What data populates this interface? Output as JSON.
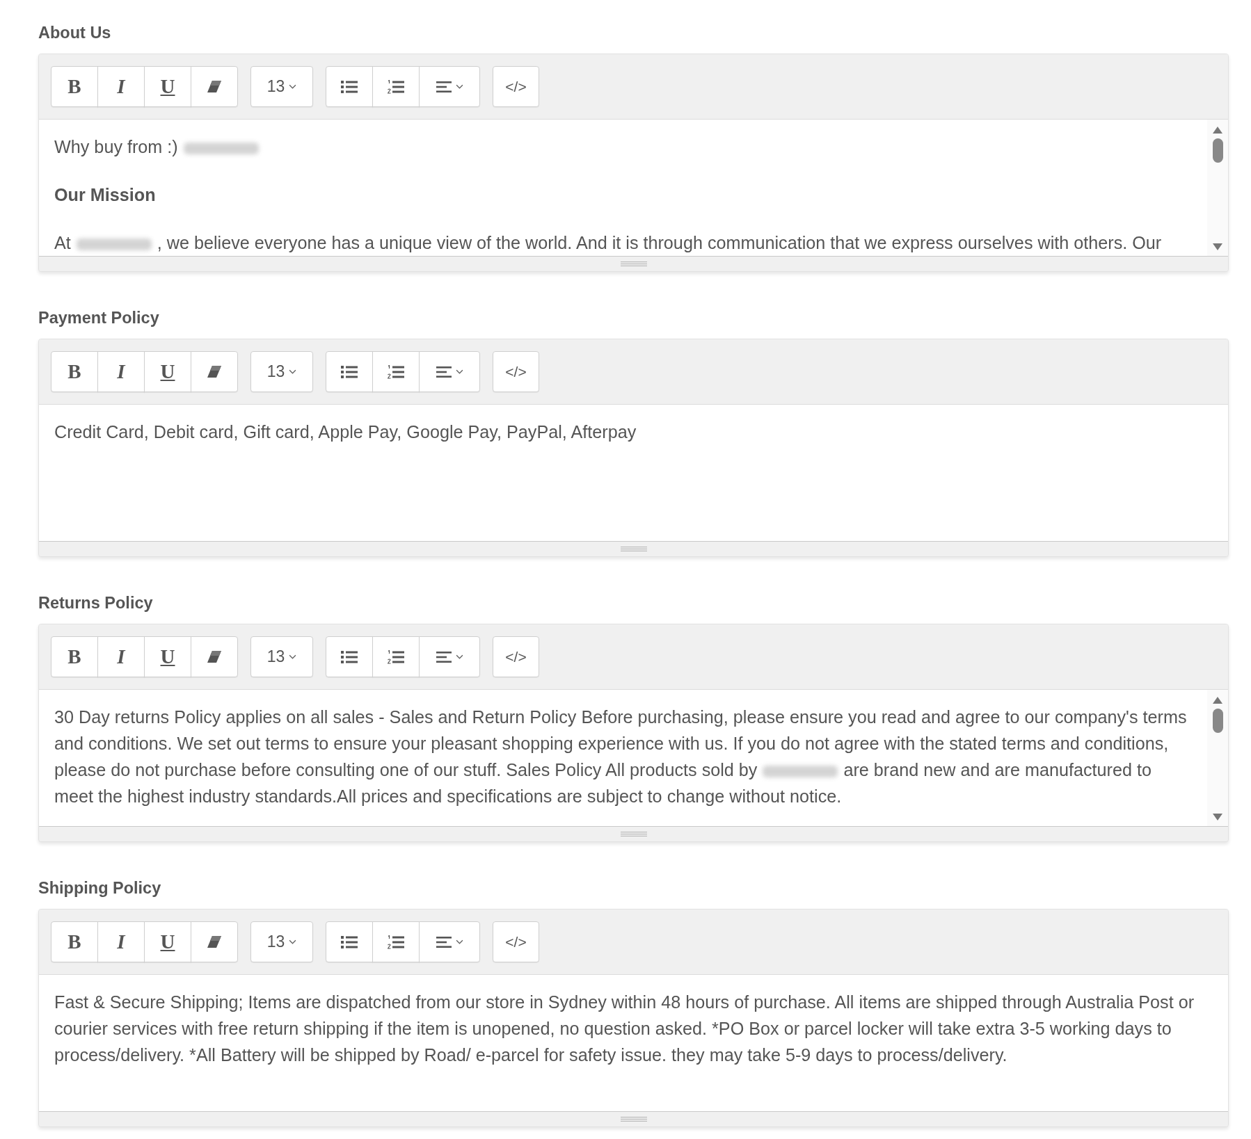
{
  "sections": [
    {
      "label": "About Us",
      "scrollable": true,
      "toolbar": [
        [
          {
            "kind": "bold",
            "label": "B"
          },
          {
            "kind": "italic",
            "label": "I"
          },
          {
            "kind": "underline",
            "label": "U"
          },
          {
            "kind": "eraser"
          }
        ],
        [
          {
            "kind": "font-size",
            "label": "13"
          }
        ],
        [
          {
            "kind": "bullet-list"
          },
          {
            "kind": "numbered-list"
          },
          {
            "kind": "align"
          }
        ],
        [
          {
            "kind": "code",
            "label": "</>"
          }
        ]
      ],
      "content": [
        {
          "bold": false,
          "parts": [
            {
              "kind": "text",
              "text": "Why buy from :)"
            },
            {
              "kind": "blur"
            }
          ]
        },
        {
          "bold": true,
          "parts": [
            {
              "kind": "text",
              "text": "Our Mission"
            }
          ]
        },
        {
          "bold": false,
          "parts": [
            {
              "kind": "text",
              "text": "At"
            },
            {
              "kind": "blur"
            },
            {
              "kind": "text",
              "text": ", we believe everyone has a unique view of the world. And it is through communication that we express ourselves with others. Our"
            }
          ]
        }
      ]
    },
    {
      "label": "Payment Policy",
      "scrollable": false,
      "toolbar": [
        [
          {
            "kind": "bold",
            "label": "B"
          },
          {
            "kind": "italic",
            "label": "I"
          },
          {
            "kind": "underline",
            "label": "U"
          },
          {
            "kind": "eraser"
          }
        ],
        [
          {
            "kind": "font-size",
            "label": "13"
          }
        ],
        [
          {
            "kind": "bullet-list"
          },
          {
            "kind": "numbered-list"
          },
          {
            "kind": "align"
          }
        ],
        [
          {
            "kind": "code",
            "label": "</>"
          }
        ]
      ],
      "content": [
        {
          "bold": false,
          "parts": [
            {
              "kind": "text",
              "text": "Credit Card, Debit card, Gift card, Apple Pay, Google Pay, PayPal, Afterpay"
            }
          ]
        }
      ]
    },
    {
      "label": "Returns Policy",
      "scrollable": true,
      "toolbar": [
        [
          {
            "kind": "bold",
            "label": "B"
          },
          {
            "kind": "italic",
            "label": "I"
          },
          {
            "kind": "underline",
            "label": "U"
          },
          {
            "kind": "eraser"
          }
        ],
        [
          {
            "kind": "font-size",
            "label": "13"
          }
        ],
        [
          {
            "kind": "bullet-list"
          },
          {
            "kind": "numbered-list"
          },
          {
            "kind": "align"
          }
        ],
        [
          {
            "kind": "code",
            "label": "</>"
          }
        ]
      ],
      "content": [
        {
          "bold": false,
          "parts": [
            {
              "kind": "text",
              "text": "30 Day returns Policy applies on all sales - Sales and Return Policy Before purchasing, please ensure you read and agree to our company's terms and conditions. We set out terms to ensure your pleasant shopping experience with us. If you do not agree with the stated terms and conditions, please do not purchase before consulting one of our stuff. Sales Policy All products sold by"
            },
            {
              "kind": "blur"
            },
            {
              "kind": "text",
              "text": "are brand new and are manufactured to meet the highest industry standards.All prices and specifications are subject to change without notice."
            }
          ]
        }
      ]
    },
    {
      "label": "Shipping Policy",
      "scrollable": false,
      "toolbar": [
        [
          {
            "kind": "bold",
            "label": "B"
          },
          {
            "kind": "italic",
            "label": "I"
          },
          {
            "kind": "underline",
            "label": "U"
          },
          {
            "kind": "eraser"
          }
        ],
        [
          {
            "kind": "font-size",
            "label": "13"
          }
        ],
        [
          {
            "kind": "bullet-list"
          },
          {
            "kind": "numbered-list"
          },
          {
            "kind": "align"
          }
        ],
        [
          {
            "kind": "code",
            "label": "</>"
          }
        ]
      ],
      "content": [
        {
          "bold": false,
          "parts": [
            {
              "kind": "text",
              "text": "Fast & Secure Shipping; Items are dispatched from our store in Sydney within 48 hours of purchase. All items are shipped through Australia Post or courier services with free return shipping if the item is unopened, no question asked. *PO Box or parcel locker will take extra 3-5 working days to process/delivery. *All Battery will be shipped by Road/ e-parcel for safety issue. they may take 5-9 days to process/delivery."
            }
          ]
        }
      ]
    }
  ]
}
